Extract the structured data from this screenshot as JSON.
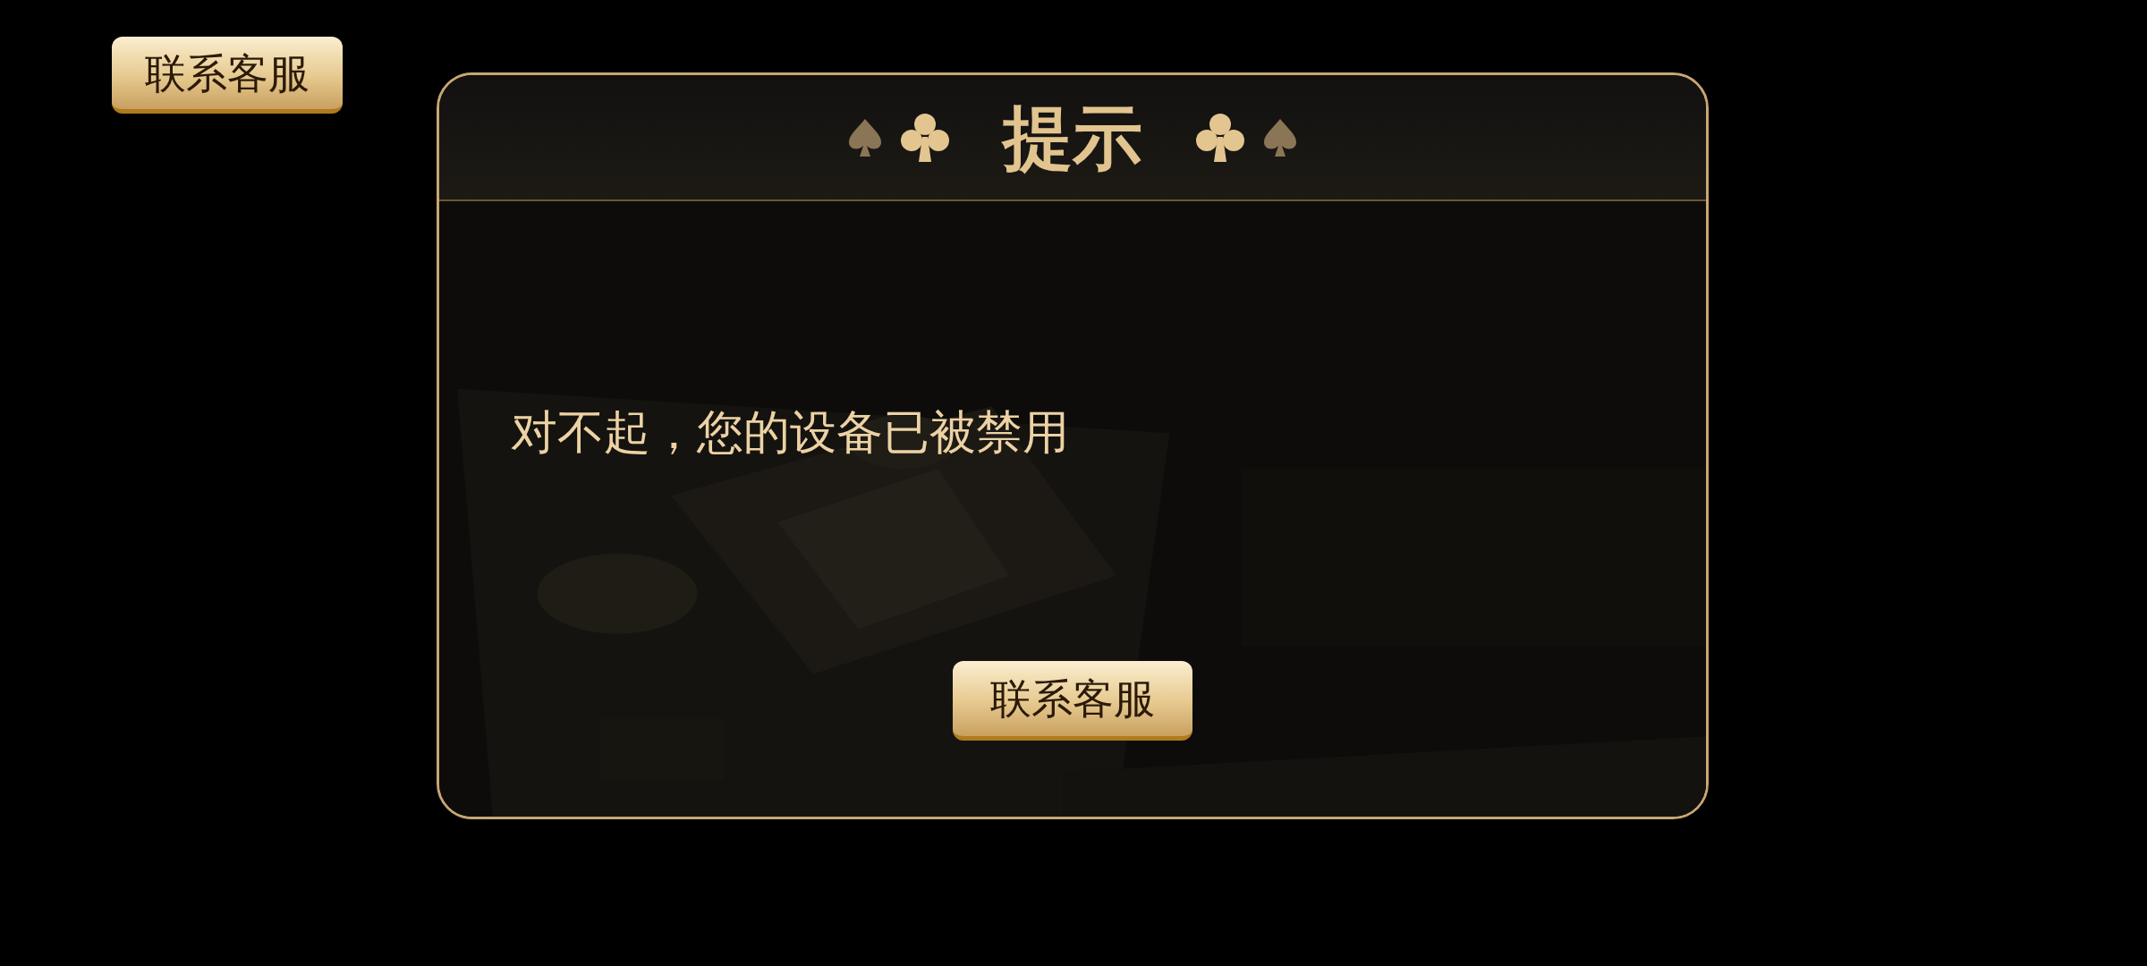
{
  "top_button": {
    "label": "联系客服"
  },
  "dialog": {
    "title": "提示",
    "message": "对不起，您的设备已被禁用",
    "button": {
      "label": "联系客服"
    }
  }
}
